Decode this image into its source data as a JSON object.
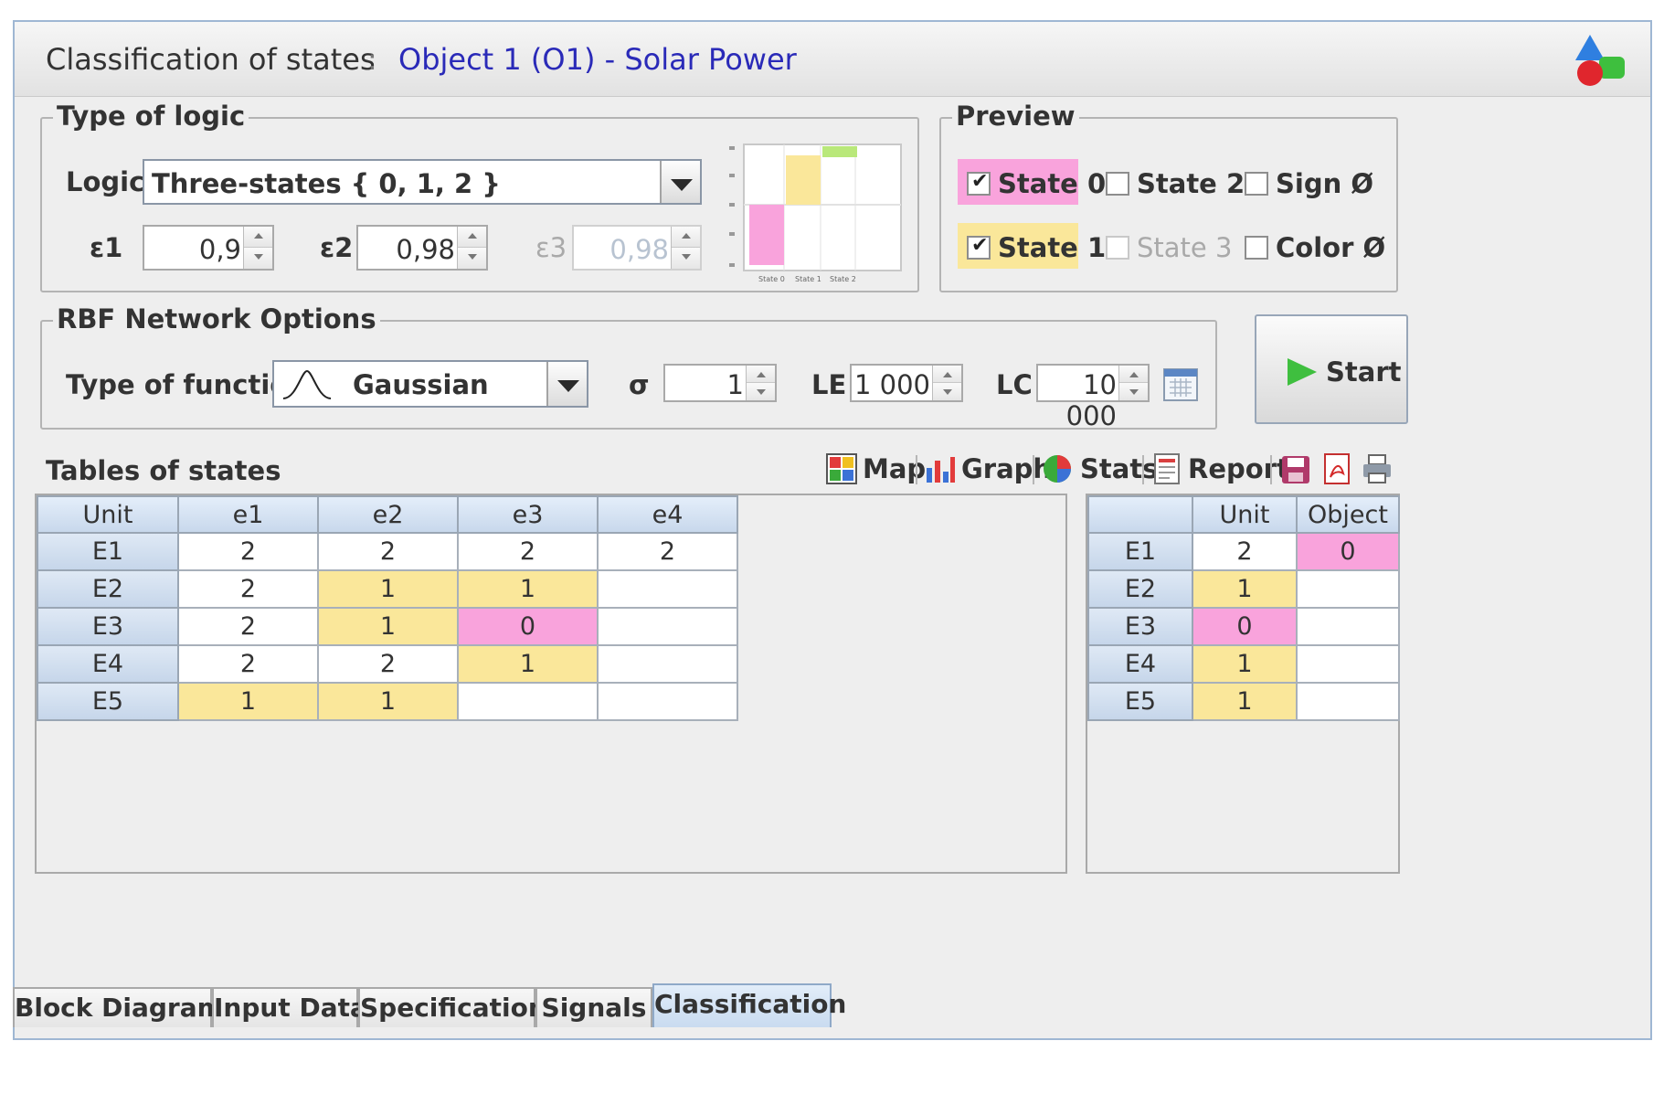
{
  "window": {
    "title_prefix": "Classification of states",
    "title_separator": ":",
    "title_object": "Object 1 (O1) - Solar Power"
  },
  "logic_group": {
    "legend": "Type of logic",
    "logic_label": "Logic",
    "logic_value": "Three-states { 0, 1, 2 }",
    "eps1_label": "ε1",
    "eps1_value": "0,9",
    "eps2_label": "ε2",
    "eps2_value": "0,98",
    "eps3_label": "ε3",
    "eps3_value": "0,98",
    "thumbnail": {
      "x_labels": [
        "State 0",
        "State 1",
        "State 2"
      ],
      "colors": {
        "state0": "#f9a3dc",
        "state1": "#fae79a",
        "state2": "#b9e87a"
      }
    }
  },
  "preview_group": {
    "legend": "Preview",
    "state0": {
      "label": "State 0",
      "checked": true,
      "color": "#f9a3dc"
    },
    "state1": {
      "label": "State 1",
      "checked": true,
      "color": "#fae79a"
    },
    "state2": {
      "label": "State 2",
      "checked": false
    },
    "state3": {
      "label": "State 3",
      "checked": false,
      "disabled": true
    },
    "sign": {
      "label": "Sign Ø",
      "checked": false
    },
    "color": {
      "label": "Color Ø",
      "checked": false
    }
  },
  "rbf_group": {
    "legend": "RBF Network Options",
    "function_label": "Type of function",
    "function_value": "Gaussian",
    "sigma_label": "σ",
    "sigma_value": "1",
    "le_label": "LE",
    "le_value": "1 000",
    "lc_label": "LC",
    "lc_value": "10 000"
  },
  "start_button": "Start",
  "tables_section": {
    "title": "Tables of states",
    "toolbar": {
      "map": "Map",
      "graph": "Graph",
      "stats": "Stats",
      "report": "Report"
    }
  },
  "left_table": {
    "columns": [
      "Unit",
      "e1",
      "e2",
      "e3",
      "e4"
    ],
    "rows": [
      [
        "E1",
        "2",
        "2",
        "2",
        "2"
      ],
      [
        "E2",
        "2",
        "1",
        "1",
        ""
      ],
      [
        "E3",
        "2",
        "1",
        "0",
        ""
      ],
      [
        "E4",
        "2",
        "2",
        "1",
        ""
      ],
      [
        "E5",
        "1",
        "1",
        "",
        ""
      ]
    ]
  },
  "right_table": {
    "columns": [
      "",
      "Unit",
      "Object"
    ],
    "rows": [
      [
        "E1",
        "2",
        "0"
      ],
      [
        "E2",
        "1",
        ""
      ],
      [
        "E3",
        "0",
        ""
      ],
      [
        "E4",
        "1",
        ""
      ],
      [
        "E5",
        "1",
        ""
      ]
    ]
  },
  "tabs": [
    "Block Diagram",
    "Input Data",
    "Specification",
    "Signals",
    "Classification"
  ],
  "active_tab": "Classification"
}
